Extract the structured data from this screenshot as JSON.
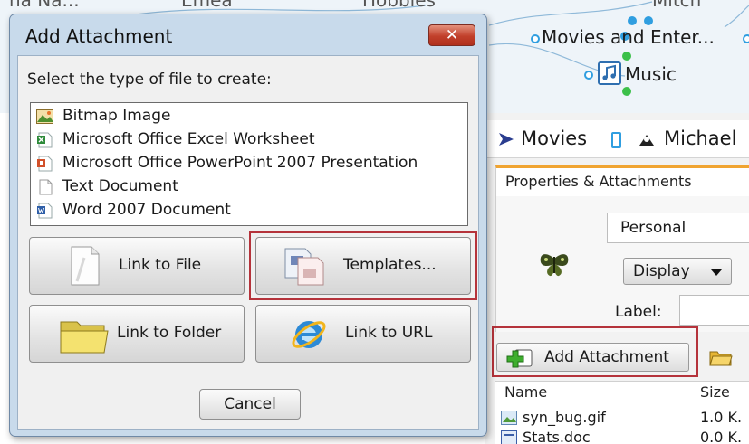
{
  "mind_map": {
    "partial_labels": [
      "na Na...",
      "Emea",
      "Hobbies",
      "Mitch"
    ],
    "movies_node": "Movies and Enter...",
    "music_node": "Music",
    "node_color": "#2f9ee0"
  },
  "right_panel": {
    "topic_bar": {
      "movies": "Movies",
      "person": "Michael"
    },
    "tab_label": "Properties & Attachments",
    "category_value": "Personal",
    "display_label": "Display",
    "label_field_label": "Label:",
    "add_attachment_label": "Add Attachment",
    "table": {
      "headers": [
        "Name",
        "Size"
      ],
      "rows": [
        {
          "name": "syn_bug.gif",
          "size": "1.0 K."
        },
        {
          "name": "Stats.doc",
          "size": "0.0 K."
        }
      ]
    }
  },
  "dialog": {
    "title": "Add Attachment",
    "close_symbol": "✕",
    "instruction": "Select the type of file to create:",
    "file_types": [
      {
        "label": "Bitmap Image",
        "icon": "bitmap-icon"
      },
      {
        "label": "Microsoft Office Excel Worksheet",
        "icon": "excel-icon"
      },
      {
        "label": "Microsoft Office PowerPoint 2007 Presentation",
        "icon": "powerpoint-icon"
      },
      {
        "label": "Text Document",
        "icon": "text-document-icon"
      },
      {
        "label": "Word 2007 Document",
        "icon": "word-icon"
      }
    ],
    "buttons": {
      "link_to_file": "Link to File",
      "templates": "Templates...",
      "link_to_folder": "Link to Folder",
      "link_to_url": "Link to URL",
      "cancel": "Cancel"
    }
  },
  "colors": {
    "highlight_box": "#b5333b",
    "dialog_frame": "#c8daeb",
    "tab_accent": "#f0a431",
    "close_button": "#c1402b"
  }
}
